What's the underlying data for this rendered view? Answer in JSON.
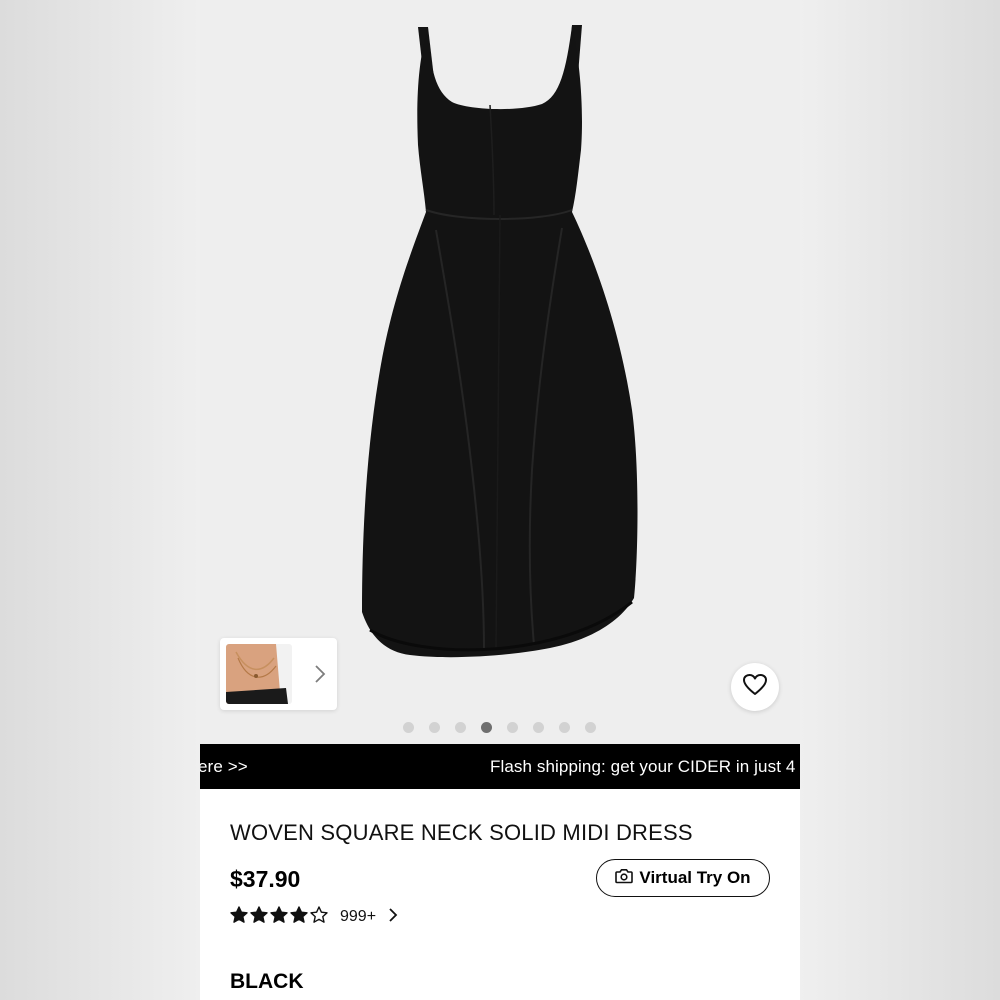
{
  "banner": {
    "left_text": "ere >>",
    "right_text": "Flash shipping: get your CIDER in just 4"
  },
  "gallery": {
    "image_count": 8,
    "active_index": 3,
    "main_image": "black-square-neck-midi-dress",
    "thumbnail_image": "necklace-model-photo"
  },
  "product": {
    "title": "WOVEN SQUARE NECK SOLID MIDI DRESS",
    "price": "$37.90",
    "virtual_try_on_label": "Virtual Try On",
    "rating_stars": 4,
    "rating_max": 5,
    "review_count": "999+",
    "color_label": "BLACK"
  },
  "icons": {
    "wishlist": "heart-outline-icon",
    "camera": "camera-icon",
    "next": "chevron-right-icon",
    "star": "star-icon"
  },
  "colors": {
    "banner_bg": "#000000",
    "banner_text": "#ffffff",
    "gallery_bg": "#eeeeee",
    "dot_active": "#6f6f6f",
    "dot_inactive": "#d2d2d2"
  }
}
